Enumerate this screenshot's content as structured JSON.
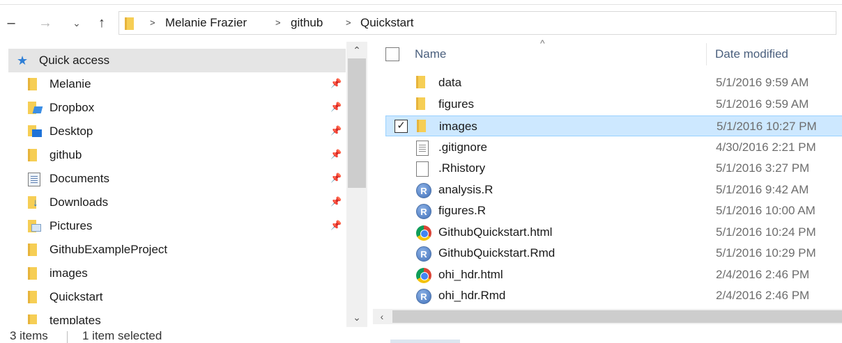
{
  "nav": {
    "back_glyph": "–",
    "forward_glyph": "→",
    "recent_glyph": "⌄",
    "up_glyph": "↑"
  },
  "breadcrumb": {
    "separator": ">",
    "items": [
      "Melanie Frazier",
      "github",
      "Quickstart"
    ]
  },
  "quick_access": {
    "label": "Quick access"
  },
  "sidebar": {
    "items": [
      {
        "label": "Melanie",
        "icon": "folder-icon",
        "pinned": true
      },
      {
        "label": "Dropbox",
        "icon": "dropbox-folder-icon",
        "pinned": true
      },
      {
        "label": "Desktop",
        "icon": "desktop-folder-icon",
        "pinned": true
      },
      {
        "label": "github",
        "icon": "folder-icon",
        "pinned": true
      },
      {
        "label": "Documents",
        "icon": "documents-icon",
        "pinned": true
      },
      {
        "label": "Downloads",
        "icon": "downloads-icon",
        "pinned": true
      },
      {
        "label": "Pictures",
        "icon": "pictures-icon",
        "pinned": true
      },
      {
        "label": "GithubExampleProject",
        "icon": "folder-icon",
        "pinned": false
      },
      {
        "label": "images",
        "icon": "folder-icon",
        "pinned": false
      },
      {
        "label": "Quickstart",
        "icon": "folder-icon",
        "pinned": false
      },
      {
        "label": "templates",
        "icon": "folder-icon",
        "pinned": false
      }
    ]
  },
  "columns": {
    "name": "Name",
    "date_modified": "Date modified"
  },
  "files": [
    {
      "name": "data",
      "date": "5/1/2016 9:59 AM",
      "icon": "folder-icon",
      "selected": false
    },
    {
      "name": "figures",
      "date": "5/1/2016 9:59 AM",
      "icon": "folder-icon",
      "selected": false
    },
    {
      "name": "images",
      "date": "5/1/2016 10:27 PM",
      "icon": "folder-icon",
      "selected": true
    },
    {
      "name": ".gitignore",
      "date": "4/30/2016 2:21 PM",
      "icon": "text-file-icon",
      "selected": false
    },
    {
      "name": ".Rhistory",
      "date": "5/1/2016 3:27 PM",
      "icon": "blank-file-icon",
      "selected": false
    },
    {
      "name": "analysis.R",
      "date": "5/1/2016 9:42 AM",
      "icon": "r-file-icon",
      "selected": false
    },
    {
      "name": "figures.R",
      "date": "5/1/2016 10:00 AM",
      "icon": "r-file-icon",
      "selected": false
    },
    {
      "name": "GithubQuickstart.html",
      "date": "5/1/2016 10:24 PM",
      "icon": "chrome-icon",
      "selected": false
    },
    {
      "name": "GithubQuickstart.Rmd",
      "date": "5/1/2016 10:29 PM",
      "icon": "r-file-icon",
      "selected": false
    },
    {
      "name": "ohi_hdr.html",
      "date": "2/4/2016 2:46 PM",
      "icon": "chrome-icon",
      "selected": false
    },
    {
      "name": "ohi_hdr.Rmd",
      "date": "2/4/2016 2:46 PM",
      "icon": "r-file-icon",
      "selected": false
    }
  ],
  "status": {
    "items_count": "3 items",
    "selected_count": "1 item selected"
  },
  "colors": {
    "selection_bg": "#cde8ff",
    "selection_border": "#99d1ff",
    "quick_access_bg": "#e5e5e5",
    "folder_yellow": "#f6ce55"
  }
}
